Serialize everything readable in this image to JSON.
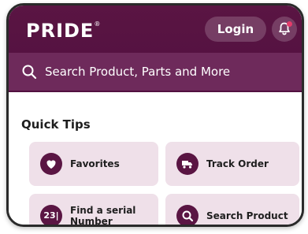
{
  "header": {
    "logo_text": "PRIDE",
    "logo_mark": "®",
    "login_label": "Login",
    "notification_icon": "bell-icon",
    "notification_dot_color": "#e43b6a",
    "brand_color": "#5a1543"
  },
  "search": {
    "placeholder": "Search Product, Parts and More",
    "icon": "search-icon"
  },
  "quick_tips": {
    "title": "Quick Tips",
    "tiles": [
      {
        "label": "Favorites",
        "icon": "heart-icon"
      },
      {
        "label": "Track Order",
        "icon": "truck-icon"
      },
      {
        "label": "Find a serial Number",
        "icon": "serial-number-icon",
        "icon_text": "23|"
      },
      {
        "label": "Search Product",
        "icon": "search-icon"
      }
    ]
  }
}
